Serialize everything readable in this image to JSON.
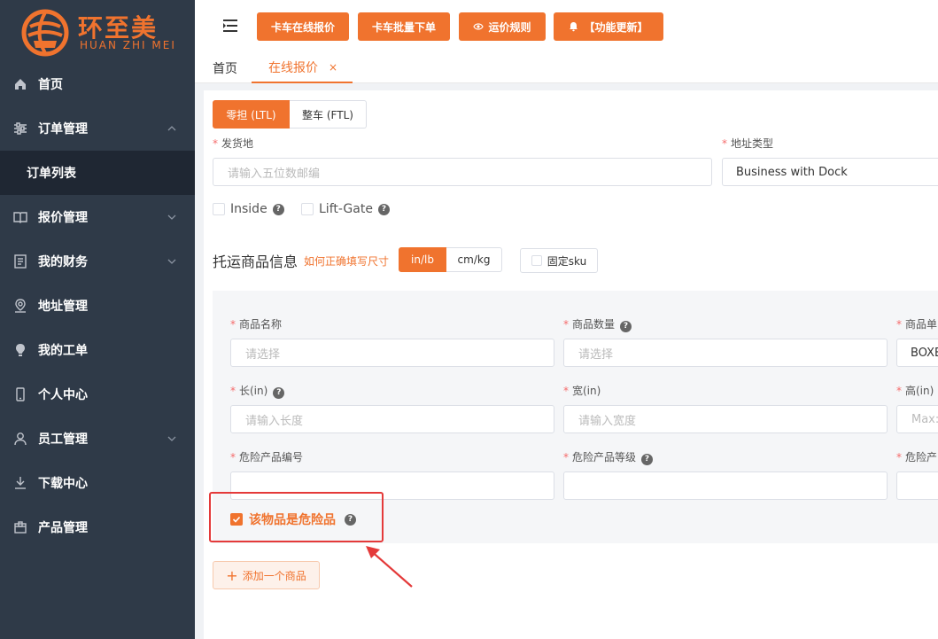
{
  "brand": {
    "name_cn": "环至美",
    "name_en": "HUAN ZHI MEI",
    "accent": "#f0732e"
  },
  "sidebar": {
    "items": [
      {
        "label": "首页",
        "icon": "home-icon"
      },
      {
        "label": "订单管理",
        "icon": "sliders-icon",
        "expanded": true,
        "children": [
          {
            "label": "订单列表"
          }
        ]
      },
      {
        "label": "报价管理",
        "icon": "book-icon"
      },
      {
        "label": "我的财务",
        "icon": "document-icon"
      },
      {
        "label": "地址管理",
        "icon": "location-icon"
      },
      {
        "label": "我的工单",
        "icon": "bulb-icon"
      },
      {
        "label": "个人中心",
        "icon": "phone-icon"
      },
      {
        "label": "员工管理",
        "icon": "user-icon"
      },
      {
        "label": "下载中心",
        "icon": "download-icon"
      },
      {
        "label": "产品管理",
        "icon": "box-icon"
      }
    ]
  },
  "header": {
    "buttons": [
      {
        "label": "卡车在线报价"
      },
      {
        "label": "卡车批量下单"
      },
      {
        "label": "运价规则",
        "icon": "eye-icon"
      },
      {
        "label": "【功能更新】",
        "icon": "bell-icon"
      }
    ]
  },
  "tabs": {
    "home": "首页",
    "active": "在线报价",
    "close": "×"
  },
  "form": {
    "mode": {
      "options": [
        "零担 (LTL)",
        "整车 (FTL)"
      ],
      "selected": "零担 (LTL)"
    },
    "origin": {
      "label": "发货地",
      "placeholder": "请输入五位数邮编"
    },
    "address_type": {
      "label": "地址类型",
      "value": "Business with Dock"
    },
    "options": [
      {
        "label": "Inside",
        "checked": false
      },
      {
        "label": "Lift-Gate",
        "checked": false
      }
    ],
    "goods_title": "托运商品信息",
    "goods_help_link": "如何正确填写尺寸",
    "units": {
      "options": [
        "in/lb",
        "cm/kg"
      ],
      "selected": "in/lb"
    },
    "fixed_sku": "固定sku",
    "goods": {
      "name": {
        "label": "商品名称",
        "placeholder": "请选择"
      },
      "qty": {
        "label": "商品数量",
        "placeholder": "请选择"
      },
      "unit": {
        "label": "商品单",
        "value": "BOXE"
      },
      "length": {
        "label": "长(in)",
        "placeholder": "请输入长度"
      },
      "width": {
        "label": "宽(in)",
        "placeholder": "请输入宽度"
      },
      "height": {
        "label": "高(in)",
        "placeholder": "Max:S"
      },
      "danger_code": {
        "label": "危险产品编号"
      },
      "danger_level": {
        "label": "危险产品等级"
      },
      "danger_other": {
        "label": "危险产"
      },
      "is_dangerous": {
        "label": "该物品是危险品",
        "checked": true
      }
    },
    "add_item": "添加一个商品"
  },
  "help_mark": "?",
  "colors": {
    "sidebar_bg": "#2f3a48",
    "submenu_bg": "#1f2733",
    "highlight_red": "#e43a3a"
  }
}
